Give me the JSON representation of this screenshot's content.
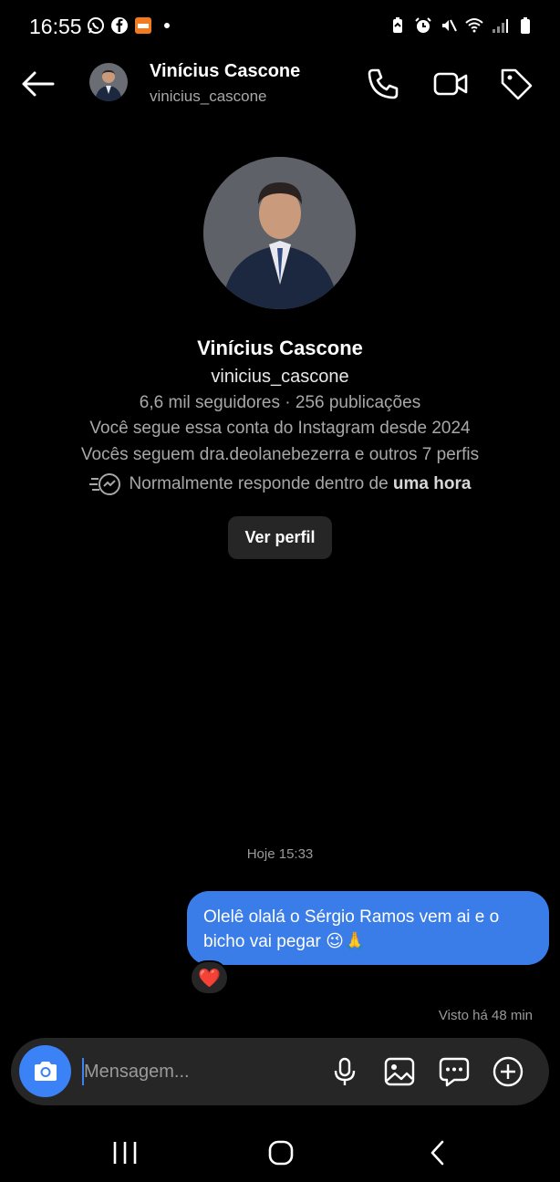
{
  "status_bar": {
    "time": "16:55",
    "left_icons": [
      "whatsapp-icon",
      "facebook-icon",
      "temu-icon",
      "dot-icon"
    ],
    "right_icons": [
      "battery-saver-icon",
      "alarm-icon",
      "mute-icon",
      "wifi-icon",
      "signal-icon",
      "battery-icon"
    ]
  },
  "header": {
    "name": "Vinícius Cascone",
    "username": "vinicius_cascone",
    "actions": [
      "phone-icon",
      "video-call-icon",
      "tag-icon"
    ]
  },
  "profile": {
    "name": "Vinícius Cascone",
    "handle": "vinicius_cascone",
    "stats": "6,6 mil seguidores · 256 publicações",
    "following_since": "Você segue essa conta do Instagram desde 2024",
    "mutual": "Vocês seguem dra.deolanebezerra e outros 7 perfis",
    "response_prefix": "Normalmente responde dentro de ",
    "response_time": "uma hora",
    "view_profile_label": "Ver perfil"
  },
  "conversation": {
    "timestamp": "Hoje 15:33",
    "messages": [
      {
        "text": "Olelê olalá o Sérgio Ramos vem ai e o bicho vai pegar 😉🙏",
        "sender": "me",
        "reaction": "❤️"
      }
    ],
    "seen": "Visto há 48 min"
  },
  "composer": {
    "placeholder": "Mensagem...",
    "value": ""
  },
  "colors": {
    "background": "#000000",
    "bubble": "#3b7de8",
    "accent": "#3b82f6",
    "surface": "#262626"
  }
}
